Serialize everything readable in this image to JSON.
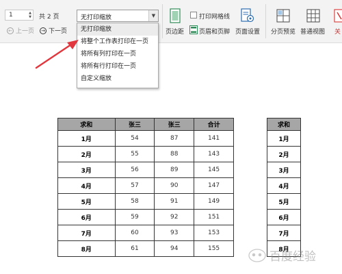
{
  "toolbar": {
    "page_input_value": "1",
    "total_pages": "共 2 页",
    "prev_label": "上一页",
    "next_label": "下一页",
    "zoom_selected": "无打印缩放",
    "zoom_options": [
      "无打印缩放",
      "将整个工作表打印在一页",
      "将所有列打印在一页",
      "将所有行打印在一页",
      "自定义缩放"
    ],
    "margins_label": "页边距",
    "print_gridlines_label": "打印网格线",
    "header_footer_label": "页眉和页脚",
    "page_setup_label": "页面设置",
    "page_break_preview_label": "分页预览",
    "normal_view_label": "普通视图",
    "close_label": "关"
  },
  "sheet_main": {
    "headers": [
      "求和",
      "张三",
      "张三",
      "合计"
    ],
    "rows": [
      [
        "1月",
        "54",
        "87",
        "141"
      ],
      [
        "2月",
        "55",
        "88",
        "143"
      ],
      [
        "3月",
        "56",
        "89",
        "145"
      ],
      [
        "4月",
        "57",
        "90",
        "147"
      ],
      [
        "5月",
        "58",
        "91",
        "149"
      ],
      [
        "6月",
        "59",
        "92",
        "151"
      ],
      [
        "7月",
        "60",
        "93",
        "153"
      ],
      [
        "8月",
        "61",
        "94",
        "155"
      ]
    ]
  },
  "sheet_side": {
    "header": "求和",
    "rows": [
      "1月",
      "2月",
      "3月",
      "4月",
      "5月",
      "6月",
      "7月",
      "8月"
    ]
  },
  "watermark_text": "百度经验",
  "colors": {
    "arrow": "#e0383e",
    "header_fill": "#a6a6a6",
    "accent_green": "#2e8b57",
    "accent_blue": "#2b6cb0"
  }
}
